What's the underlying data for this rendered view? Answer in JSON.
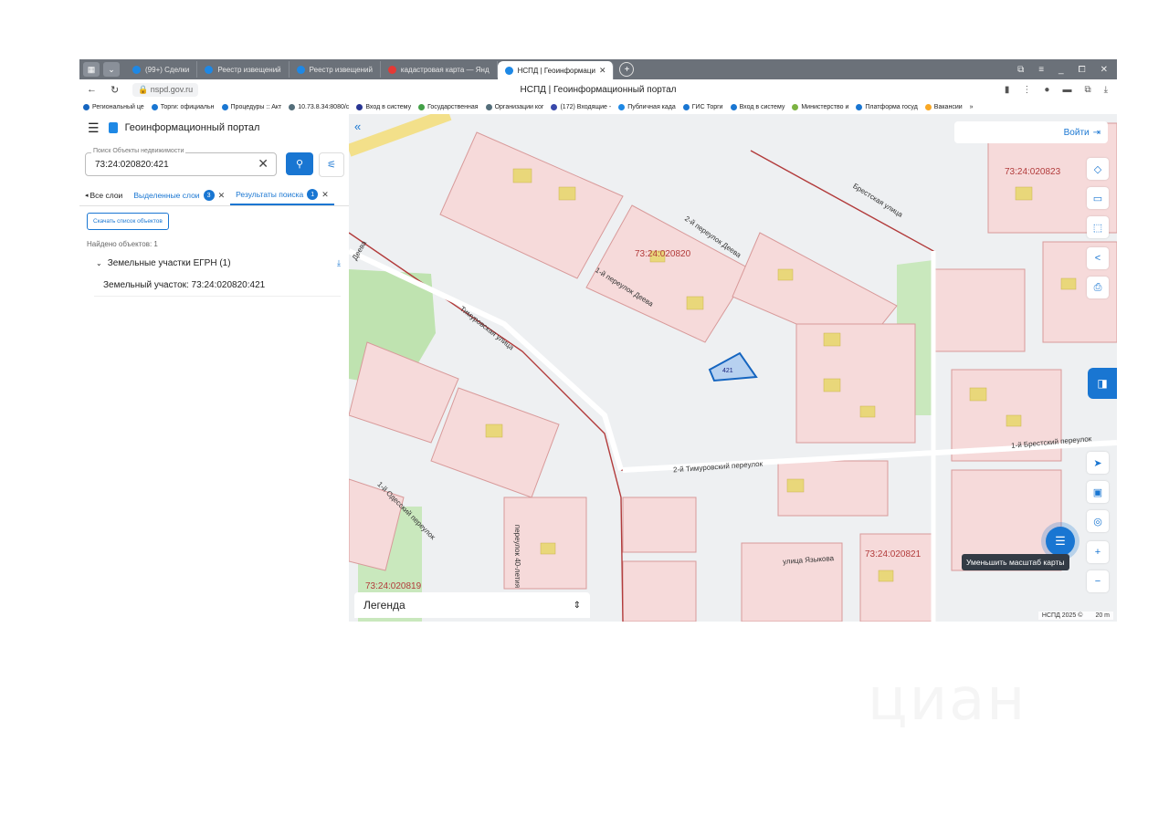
{
  "browser": {
    "tabs": [
      {
        "label": "(99+) Сделки",
        "color": "#1e88e5"
      },
      {
        "label": "Реестр извещений",
        "color": "#1e88e5"
      },
      {
        "label": "Реестр извещений",
        "color": "#1e88e5"
      },
      {
        "label": "кадастровая карта — Янд",
        "color": "#e53935"
      },
      {
        "label": "НСПД | Геоинформаци",
        "color": "#1e88e5",
        "active": true
      }
    ],
    "url": "nspd.gov.ru",
    "page_title": "НСПД | Геоинформационный портал",
    "bookmarks": [
      {
        "label": "Региональный це",
        "color": "#1565c0"
      },
      {
        "label": "Торги: официальн",
        "color": "#1976d2"
      },
      {
        "label": "Процедуры :: Акт",
        "color": "#1976d2"
      },
      {
        "label": "10.73.8.34:8080/c",
        "color": "#546e7a"
      },
      {
        "label": "Вход в систему",
        "color": "#283593"
      },
      {
        "label": "Государственная",
        "color": "#43a047"
      },
      {
        "label": "Организации ког",
        "color": "#546e7a"
      },
      {
        "label": "(172) Входящие -",
        "color": "#3949ab"
      },
      {
        "label": "Публичная када",
        "color": "#1e88e5"
      },
      {
        "label": "ГИС Торги",
        "color": "#1976d2"
      },
      {
        "label": "Вход в систему",
        "color": "#1976d2"
      },
      {
        "label": "Министерство и",
        "color": "#7cb342"
      },
      {
        "label": "Платформа госуд",
        "color": "#1976d2"
      },
      {
        "label": "Вакансии",
        "color": "#f9a825"
      }
    ]
  },
  "panel": {
    "title": "Геоинформационный портал",
    "search_label": "Поиск Объекты недвижимости",
    "search_value": "73:24:020820:421",
    "tab_all": "Все слои",
    "tab_selected": "Выделенные слои",
    "tab_selected_count": "3",
    "tab_results": "Результаты поиска",
    "tab_results_count": "1",
    "download_label": "Скачать список объектов",
    "found_text": "Найдено объектов: 1",
    "group_label": "Земельные участки ЕГРН (1)",
    "result_label": "Земельный участок: 73:24:020820:421"
  },
  "map": {
    "login_label": "Войти",
    "cadastral_blocks": [
      "73:24:020820",
      "73:24:020823",
      "73:24:020821",
      "73:24:020819"
    ],
    "streets": [
      "Брестская улица",
      "2-й переулок Деева",
      "1-й переулок Деева",
      "Тимуровская улица",
      "2-й Тимуровский переулок",
      "1-й Брестский переулок",
      "улица Языкова",
      "1-й Одесский переулок",
      "переулок 40-летия",
      "Деева"
    ],
    "selected_parcel": "421",
    "legend_label": "Легенда",
    "tooltip": "Уменьшить масштаб карты",
    "copyright": "НСПД 2025 ©",
    "scale": "20 m"
  },
  "watermark": "циан"
}
